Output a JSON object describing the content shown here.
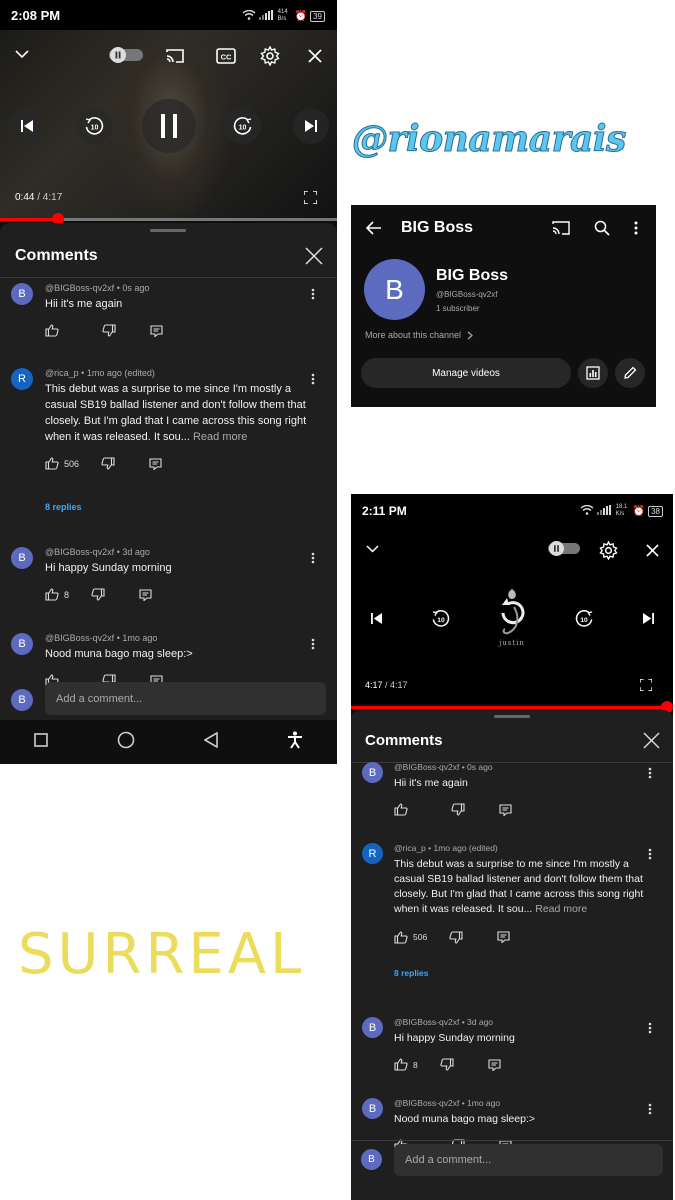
{
  "overlay": {
    "handle": "@rionamarais",
    "surreal": "SURREAL"
  },
  "phone1": {
    "status": {
      "time": "2:08 PM",
      "net_speed": "414 B/s",
      "battery": "39"
    },
    "player": {
      "elapsed": "0:44",
      "duration": "/ 4:17",
      "progress": 0.171
    },
    "comments_title": "Comments",
    "add_placeholder": "Add a comment...",
    "add_avatar": "B"
  },
  "phone2": {
    "status": {
      "time": "2:11 PM",
      "net_speed": "18.1 K/s",
      "battery": "38"
    },
    "player": {
      "elapsed": "4:17",
      "duration": "/ 4:17",
      "progress": 1.0,
      "artwork_text": "justin"
    },
    "comments_title": "Comments",
    "add_placeholder": "Add a comment...",
    "add_avatar": "B"
  },
  "comments": [
    {
      "avatar": "B",
      "avatar_color": "#5c6bc0",
      "author": "@BIGBoss-qv2xf",
      "time": "• 0s ago",
      "text": "Hii it's me again",
      "likes": "",
      "read_more": ""
    },
    {
      "avatar": "R",
      "avatar_color": "#1565c0",
      "author": "@rica_p",
      "time": "• 1mo ago (edited)",
      "text": "This debut was a surprise to me since I'm mostly a casual SB19 ballad listener and don't follow them that closely. But I'm glad that I came across this song right when it was released. It sou...",
      "likes": "506",
      "read_more": "Read more",
      "replies": "8 replies"
    },
    {
      "avatar": "B",
      "avatar_color": "#5c6bc0",
      "author": "@BIGBoss-qv2xf",
      "time": "• 3d ago",
      "text": "Hi happy Sunday morning",
      "likes": "8",
      "read_more": ""
    },
    {
      "avatar": "B",
      "avatar_color": "#5c6bc0",
      "author": "@BIGBoss-qv2xf",
      "time": "• 1mo ago",
      "text": "Nood muna bago mag sleep:>",
      "likes": "",
      "read_more": ""
    }
  ],
  "channel": {
    "header_title": "BIG Boss",
    "avatar": "B",
    "name": "BIG Boss",
    "handle": "@BIGBoss-qv2xf",
    "subscribers": "1 subscriber",
    "more_about": "More about this channel",
    "manage_label": "Manage videos"
  },
  "colors": {
    "accent_red": "#ff0000",
    "link_blue": "#3ea6ff",
    "avatar_purple": "#5c6bc0"
  }
}
